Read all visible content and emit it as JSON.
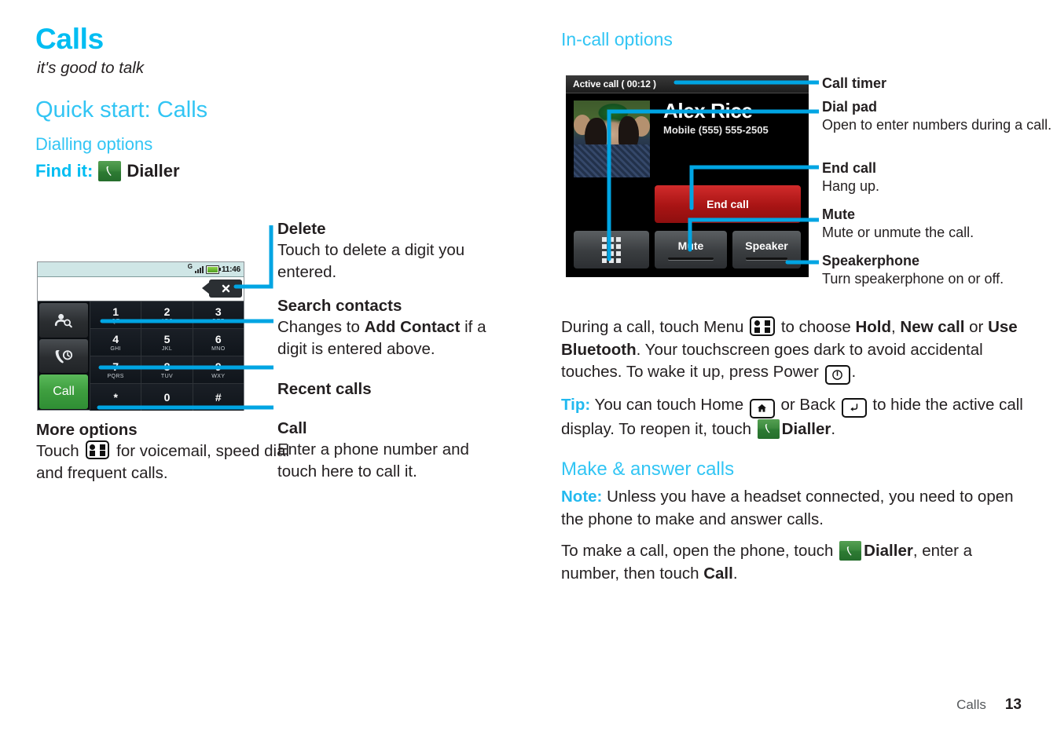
{
  "chapter": {
    "title": "Calls",
    "subtitle": "it's good to talk"
  },
  "left": {
    "quickstart_heading": "Quick start: Calls",
    "dialling_heading": "Dialling options",
    "find_it_label": "Find it:",
    "find_it_app": "Dialler",
    "dialler_icon": "phone-handset-icon"
  },
  "dialler_mock": {
    "status_network": "G",
    "status_time": "11:46",
    "signal_icon": "signal-bars-icon",
    "battery_icon": "battery-icon",
    "delete_icon": "delete-x-icon",
    "search_contacts_icon": "contact-search-icon",
    "recent_calls_icon": "recent-calls-icon",
    "call_label": "Call",
    "keys": [
      {
        "digit": "1",
        "letters": "QZ"
      },
      {
        "digit": "2",
        "letters": "ABC"
      },
      {
        "digit": "3",
        "letters": "DEF"
      },
      {
        "digit": "4",
        "letters": "GHI"
      },
      {
        "digit": "5",
        "letters": "JKL"
      },
      {
        "digit": "6",
        "letters": "MNO"
      },
      {
        "digit": "7",
        "letters": "PQRS"
      },
      {
        "digit": "8",
        "letters": "TUV"
      },
      {
        "digit": "9",
        "letters": "WXY"
      },
      {
        "digit": "*",
        "letters": ""
      },
      {
        "digit": "0",
        "letters": ""
      },
      {
        "digit": "#",
        "letters": ""
      }
    ]
  },
  "more_options": {
    "heading": "More options",
    "text_before": "Touch",
    "icon": "menu-grid-icon",
    "text_after": "for voicemail, speed dial and frequent calls."
  },
  "left_callouts": [
    {
      "heading": "Delete",
      "text": "Touch to delete a digit you entered."
    },
    {
      "heading": "Search contacts",
      "text_1": "Changes to ",
      "text_bold": "Add Contact",
      "text_2": " if a digit is entered above."
    },
    {
      "heading": "Recent calls",
      "text": ""
    },
    {
      "heading": "Call",
      "text": "Enter a phone number and touch here to call it."
    }
  ],
  "right": {
    "incall_heading": "In-call options"
  },
  "incall_mock": {
    "title": "Active call ( 00:12 )",
    "contact_name": "Alex Rice",
    "contact_number": "Mobile (555) 555-2505",
    "end_call_label": "End call",
    "mute_label": "Mute",
    "speaker_label": "Speaker",
    "dialpad_icon": "dialpad-grid-icon"
  },
  "right_callouts": [
    {
      "heading": "Call timer",
      "text": ""
    },
    {
      "heading": "Dial pad",
      "text": "Open to enter numbers during a call."
    },
    {
      "heading": "End call",
      "text": "Hang up."
    },
    {
      "heading": "Mute",
      "text": "Mute or unmute the call."
    },
    {
      "heading": "Speakerphone",
      "text": "Turn speakerphone on or off."
    }
  ],
  "body": {
    "p1_a": "During a call, touch Menu ",
    "p1_menu_icon": "menu-grid-icon",
    "p1_b": " to choose ",
    "p1_hold": "Hold",
    "p1_c": ", ",
    "p1_newcall": "New call",
    "p1_d": " or ",
    "p1_bluetooth": "Use Bluetooth",
    "p1_e": ". Your touchscreen goes dark to avoid accidental touches. To wake it up, press Power ",
    "p1_power_icon": "power-icon",
    "p1_f": ".",
    "tip_label": "Tip:",
    "tip_a": " You can touch Home ",
    "tip_home_icon": "home-icon",
    "tip_b": " or Back ",
    "tip_back_icon": "back-arrow-icon",
    "tip_c": " to hide the active call display. To reopen it, touch ",
    "tip_dialler": "Dialler",
    "tip_d": ".",
    "make_heading": "Make & answer calls",
    "note_label": "Note:",
    "note_text": " Unless you have a headset connected, you need to open the phone to make and answer calls.",
    "p3_a": "To make a call, open the phone, touch ",
    "p3_dialler": "Dialler",
    "p3_b": ", enter a number, then touch ",
    "p3_call": "Call",
    "p3_c": "."
  },
  "footer": {
    "section": "Calls",
    "page": "13"
  },
  "colors": {
    "accent_cyan": "#22b9ef",
    "heading_cyan": "#32c5f4",
    "callout_line": "#00a5e3",
    "green_app": "#3c8a3e",
    "end_call_red": "#a81414"
  }
}
